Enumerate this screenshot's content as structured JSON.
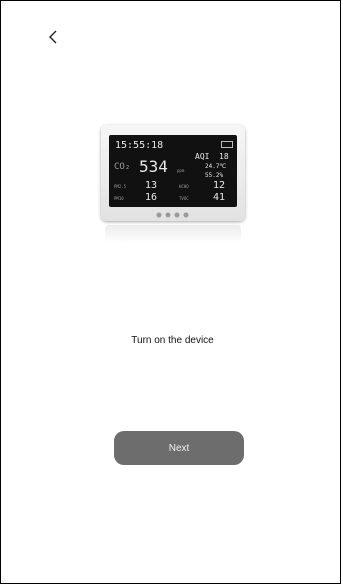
{
  "nav": {
    "back_icon": "chevron-left-icon"
  },
  "device": {
    "time": "15:55:18",
    "co2_label": "CO₂",
    "co2_value": "534",
    "co2_unit": "ppm",
    "aqi_label": "AQI",
    "aqi_value": "18",
    "temperature": "24.7℃",
    "humidity": "55.2%",
    "pm25_label": "PM2.5",
    "pm25_value": "13",
    "pm10_label": "PM10",
    "pm10_value": "16",
    "hcho_label": "HCHO",
    "hcho_value": "12",
    "tvoc_label": "TVOC",
    "tvoc_value": "41"
  },
  "main": {
    "instruction": "Turn on the device",
    "next_label": "Next"
  },
  "colors": {
    "button_bg": "#6d6d6d",
    "button_text": "#f2f2f2"
  }
}
